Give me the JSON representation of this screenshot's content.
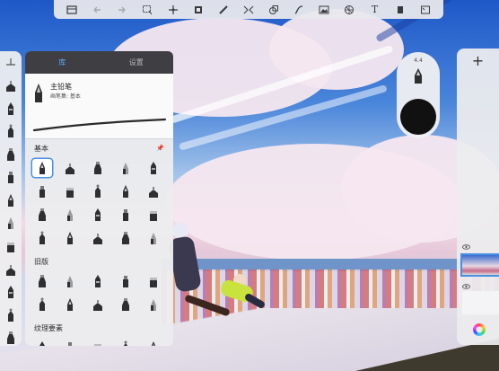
{
  "toolbar": {
    "items": [
      {
        "icon": "gallery-icon"
      },
      {
        "icon": "undo-icon",
        "enabled": false
      },
      {
        "icon": "redo-icon",
        "enabled": false
      },
      {
        "icon": "selection-icon"
      },
      {
        "icon": "transform-icon"
      },
      {
        "icon": "crop-icon"
      },
      {
        "icon": "ruler-icon"
      },
      {
        "icon": "symmetry-icon"
      },
      {
        "icon": "shape-icon"
      },
      {
        "icon": "curve-icon"
      },
      {
        "icon": "import-image-icon"
      },
      {
        "icon": "perspective-grid-icon"
      },
      {
        "icon": "text-icon",
        "glyph": "T"
      },
      {
        "icon": "flipbook-icon"
      },
      {
        "icon": "fullscreen-icon"
      }
    ]
  },
  "brush_panel": {
    "tabs": [
      {
        "label": "库",
        "active": true
      },
      {
        "label": "设置",
        "active": false
      }
    ],
    "current_brush": {
      "name": "主铅笔",
      "set": "画笔集: 基本"
    },
    "sections": [
      {
        "title": "基本",
        "pinned": true,
        "brush_count": 20,
        "selected_index": 0
      },
      {
        "title": "旧版",
        "pinned": false,
        "brush_count": 10,
        "selected_index": -1
      },
      {
        "title": "纹理要素",
        "pinned": false,
        "brush_count": 5,
        "selected_index": -1
      }
    ]
  },
  "left_strip": {
    "brush_count": 12,
    "active_index": 1
  },
  "puck": {
    "size_label": "4.4",
    "color": "#111111"
  },
  "layers": {
    "add_label": "+"
  },
  "colors": {
    "accent": "#4a90e2",
    "panel_dark": "#3f3f43",
    "tab_active": "#5aa8ff"
  }
}
